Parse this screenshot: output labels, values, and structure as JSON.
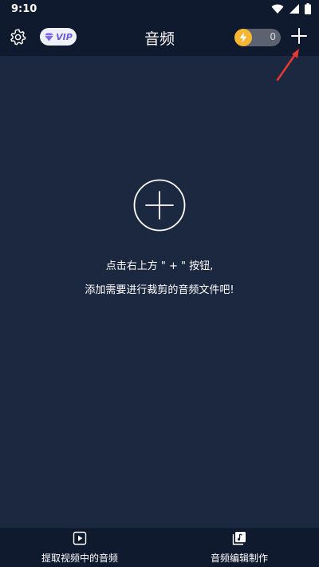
{
  "status_bar": {
    "time": "9:10",
    "icons": [
      "wifi-icon",
      "signal-icon",
      "battery-icon"
    ]
  },
  "header": {
    "title": "音频",
    "vip_label": "VIP",
    "coin_count": "0",
    "icons": [
      "gear-icon",
      "diamond-icon",
      "lightning-icon",
      "plus-icon"
    ]
  },
  "empty_state": {
    "line1": "点击右上方 \" + \" 按钮,",
    "line2": "添加需要进行裁剪的音频文件吧!",
    "icon": "circle-plus-icon"
  },
  "tabs": [
    {
      "label": "提取视频中的音频",
      "icon": "video-play-icon"
    },
    {
      "label": "音频编辑制作",
      "icon": "music-note-icon"
    }
  ],
  "colors": {
    "background": "#1c2740",
    "bar_background": "#0f1a2e",
    "accent_vip": "#6b5ae0",
    "coin": "#f7b733",
    "annotation_arrow": "#e53935"
  }
}
